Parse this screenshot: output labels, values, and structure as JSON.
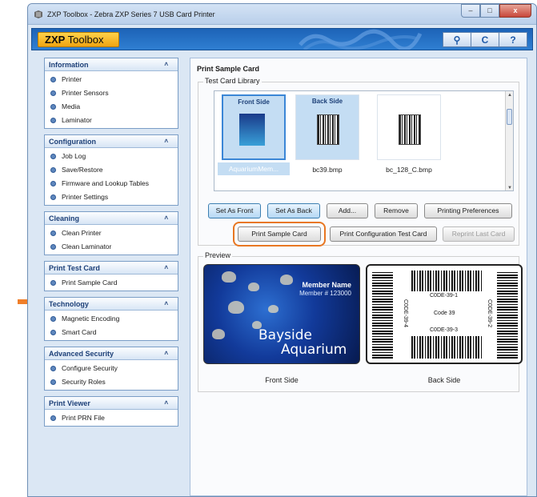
{
  "window": {
    "title": "ZXP Toolbox - Zebra ZXP Series 7 USB Card Printer",
    "controls": {
      "minimize": "–",
      "maximize": "□",
      "close": "x"
    }
  },
  "header": {
    "logo_bold": "ZXP",
    "logo_thin": " Toolbox",
    "tools": {
      "search": "🔍",
      "refresh": "C",
      "help": "?"
    }
  },
  "sidebar": {
    "sections": [
      {
        "title": "Information",
        "items": [
          "Printer",
          "Printer Sensors",
          "Media",
          "Laminator"
        ]
      },
      {
        "title": "Configuration",
        "items": [
          "Job Log",
          "Save/Restore",
          "Firmware and Lookup Tables",
          "Printer Settings"
        ]
      },
      {
        "title": "Cleaning",
        "items": [
          "Clean Printer",
          "Clean Laminator"
        ]
      },
      {
        "title": "Print Test Card",
        "items": [
          "Print Sample Card"
        ]
      },
      {
        "title": "Technology",
        "items": [
          "Magnetic Encoding",
          "Smart Card"
        ]
      },
      {
        "title": "Advanced Security",
        "items": [
          "Configure Security",
          "Security Roles"
        ]
      },
      {
        "title": "Print Viewer",
        "items": [
          "Print PRN File"
        ]
      }
    ],
    "chevron": "˄"
  },
  "main": {
    "title": "Print Sample Card",
    "library_label": "Test Card Library",
    "library": [
      {
        "badge": "Front Side",
        "name": "AquariumMem..."
      },
      {
        "badge": "Back Side",
        "name": "bc39.bmp"
      },
      {
        "badge": "",
        "name": "bc_128_C.bmp"
      }
    ],
    "buttons": {
      "set_front": "Set As Front",
      "set_back": "Set As Back",
      "add": "Add...",
      "remove": "Remove",
      "printing_prefs": "Printing Preferences",
      "print_sample": "Print Sample Card",
      "print_config": "Print Configuration Test Card",
      "reprint_last": "Reprint Last Card"
    },
    "preview_label": "Preview",
    "front_card": {
      "member_name": "Member Name",
      "member_number": "Member # 123000",
      "brand_line1": "Bayside",
      "brand_line2": "Aquarium"
    },
    "back_card": {
      "code_top": "C0DE-39-1",
      "code_middle": "Code 39",
      "code_bottom": "C0DE-39-3",
      "code_left": "C0DE-39-4",
      "code_right": "C0DE-39-2"
    },
    "front_caption": "Front Side",
    "back_caption": "Back Side"
  },
  "colors": {
    "accent_orange": "#e87722",
    "header_blue": "#2f7fd1",
    "logo_yellow": "#f0a410"
  }
}
